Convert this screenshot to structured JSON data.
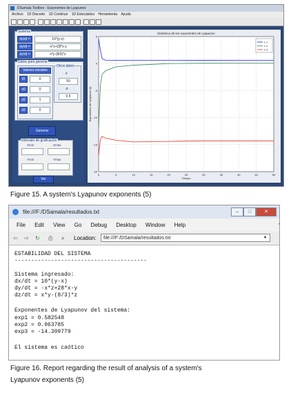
{
  "figure1": {
    "window_title": "DSamala Toolbox - Exponentes de Lyapunov",
    "menu": [
      "Archivo",
      "1D Discreto",
      "1D Continuo",
      "1D Estocástico",
      "Herramienta",
      "Ayuda"
    ],
    "panel_sistema_label": "Sistema",
    "equations": [
      {
        "var": "dx/dt =",
        "expr": "10*(y-x)"
      },
      {
        "var": "dy/dt =",
        "expr": "-x*z+28*x-y"
      },
      {
        "var": "dz/dt =",
        "expr": "x*y-(8/3)*z"
      }
    ],
    "panel_datos_label": "Datos para generar",
    "valores_iniciales_label": "Valores iniciales",
    "otros_label": "Otros datos",
    "initial": [
      {
        "var": "t0",
        "value": "0"
      },
      {
        "var": "x0",
        "value": "0"
      },
      {
        "var": "y0",
        "value": "1"
      },
      {
        "var": "z0",
        "value": "0"
      }
    ],
    "tf_label": "tf",
    "tf_value": "50",
    "dt_label": "dt",
    "dt_value": "0.5",
    "generar_label": "Generar",
    "panel_int_label": "Intervalo de graficación",
    "xmin_label": "Xmin",
    "xmax_label": "Xmax",
    "ymin_label": "Ymin",
    "ymax_label": "Ymax",
    "ver_label": "Ver",
    "chart_data": {
      "type": "line",
      "title": "Dinámica de los exponentes de Lyapunov",
      "xlabel": "Tiempo",
      "ylabel": "Exponentes de Lyapunov (λ)",
      "xlim": [
        0,
        50
      ],
      "ylim": [
        -20,
        5
      ],
      "x_ticks": [
        "0",
        "5",
        "10",
        "15",
        "20",
        "25",
        "30",
        "35",
        "40",
        "45",
        "50"
      ],
      "y_ticks": [
        "5",
        "0",
        "-5",
        "-10",
        "-15",
        "-20"
      ],
      "grid": true,
      "legend_position": "top-right",
      "series": [
        {
          "name": "λ 1",
          "color": "#1a1aff",
          "x": [
            0,
            0.5,
            1,
            2,
            5,
            10,
            20,
            30,
            40,
            50
          ],
          "y": [
            4.5,
            2.5,
            0.9,
            0.6,
            0.58,
            0.58,
            0.6,
            0.59,
            0.58,
            0.58
          ]
        },
        {
          "name": "λ 2",
          "color": "#2e8b57",
          "x": [
            0,
            0.5,
            1,
            2,
            5,
            10,
            20,
            30,
            40,
            50
          ],
          "y": [
            -12,
            -4,
            -2,
            -1.3,
            -0.6,
            -0.3,
            0,
            0.05,
            0.06,
            0.06
          ]
        },
        {
          "name": "λ 3",
          "color": "#e03020",
          "x": [
            0,
            0.5,
            1,
            2,
            5,
            10,
            20,
            30,
            40,
            50
          ],
          "y": [
            -17,
            -14,
            -13.5,
            -13.8,
            -14.2,
            -14.5,
            -14.4,
            -14.3,
            -14.3,
            -14.3
          ]
        }
      ]
    }
  },
  "caption1": "Figure 15. A system's Lyapunov exponents (5)",
  "figure2": {
    "window_title": "file:///F:/DSamala/resultados.txt",
    "menu": [
      "File",
      "Edit",
      "View",
      "Go",
      "Debug",
      "Desktop",
      "Window",
      "Help"
    ],
    "location_label": "Location:",
    "location_value": "file:///F:/DSamala/resultados.txt",
    "lines": [
      "ESTABILIDAD DEL SISTEMA",
      "----------------------------------------",
      "",
      "Sistema ingresado:",
      "dx/dt = 10*(y-x)",
      "dy/dt = -x*z+28*x-y",
      "dz/dt = x*y-(8/3)*z",
      "",
      "Exponentes de Lyapunov del sistema:",
      "exp1 = 0.582548",
      "exp2 = 0.063785",
      "exp3 = -14.309779",
      "",
      "El sistema es caótico"
    ]
  },
  "caption2_line1": "Figure 16. Report regarding the result of analysis of a system's",
  "caption2_line2": "Lyapunov exponents (5)"
}
